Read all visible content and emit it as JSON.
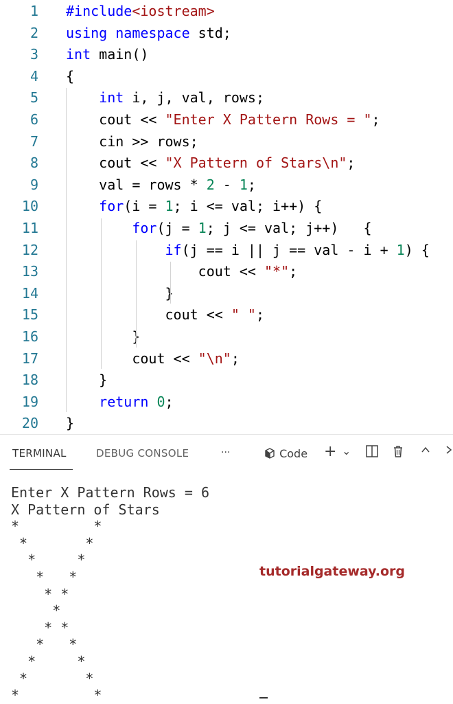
{
  "code": [
    {
      "n": "1",
      "parts": [
        {
          "t": "#include",
          "c": "kw"
        },
        {
          "t": "<iostream>",
          "c": "str"
        }
      ]
    },
    {
      "n": "2",
      "parts": [
        {
          "t": "using namespace",
          "c": "kw"
        },
        {
          "t": " std;",
          "c": ""
        }
      ]
    },
    {
      "n": "3",
      "parts": [
        {
          "t": "int",
          "c": "kw"
        },
        {
          "t": " main()",
          "c": ""
        }
      ]
    },
    {
      "n": "4",
      "parts": [
        {
          "t": "{",
          "c": ""
        }
      ]
    },
    {
      "n": "5",
      "parts": [
        {
          "t": "    ",
          "c": ""
        },
        {
          "t": "int",
          "c": "kw"
        },
        {
          "t": " i, j, val, rows;",
          "c": ""
        }
      ]
    },
    {
      "n": "6",
      "parts": [
        {
          "t": "    cout << ",
          "c": ""
        },
        {
          "t": "\"Enter X Pattern Rows = \"",
          "c": "str"
        },
        {
          "t": ";",
          "c": ""
        }
      ]
    },
    {
      "n": "7",
      "parts": [
        {
          "t": "    cin >> rows;",
          "c": ""
        }
      ]
    },
    {
      "n": "8",
      "parts": [
        {
          "t": "    cout << ",
          "c": ""
        },
        {
          "t": "\"X Pattern of Stars\\n\"",
          "c": "str"
        },
        {
          "t": ";",
          "c": ""
        }
      ]
    },
    {
      "n": "9",
      "parts": [
        {
          "t": "    val = rows * ",
          "c": ""
        },
        {
          "t": "2",
          "c": "num"
        },
        {
          "t": " - ",
          "c": ""
        },
        {
          "t": "1",
          "c": "num"
        },
        {
          "t": ";",
          "c": ""
        }
      ]
    },
    {
      "n": "10",
      "parts": [
        {
          "t": "    ",
          "c": ""
        },
        {
          "t": "for",
          "c": "kw"
        },
        {
          "t": "(i = ",
          "c": ""
        },
        {
          "t": "1",
          "c": "num"
        },
        {
          "t": "; i <= val; i++) {",
          "c": ""
        }
      ]
    },
    {
      "n": "11",
      "parts": [
        {
          "t": "        ",
          "c": ""
        },
        {
          "t": "for",
          "c": "kw"
        },
        {
          "t": "(j = ",
          "c": ""
        },
        {
          "t": "1",
          "c": "num"
        },
        {
          "t": "; j <= val; j++)   {",
          "c": ""
        }
      ]
    },
    {
      "n": "12",
      "parts": [
        {
          "t": "            ",
          "c": ""
        },
        {
          "t": "if",
          "c": "kw"
        },
        {
          "t": "(j == i || j == val - i + ",
          "c": ""
        },
        {
          "t": "1",
          "c": "num"
        },
        {
          "t": ") {",
          "c": ""
        }
      ]
    },
    {
      "n": "13",
      "parts": [
        {
          "t": "                cout << ",
          "c": ""
        },
        {
          "t": "\"*\"",
          "c": "str"
        },
        {
          "t": ";",
          "c": ""
        }
      ]
    },
    {
      "n": "14",
      "parts": [
        {
          "t": "            }",
          "c": ""
        }
      ]
    },
    {
      "n": "15",
      "parts": [
        {
          "t": "            cout << ",
          "c": ""
        },
        {
          "t": "\" \"",
          "c": "str"
        },
        {
          "t": ";",
          "c": ""
        }
      ]
    },
    {
      "n": "16",
      "parts": [
        {
          "t": "        }",
          "c": ""
        }
      ]
    },
    {
      "n": "17",
      "parts": [
        {
          "t": "        cout << ",
          "c": ""
        },
        {
          "t": "\"\\n\"",
          "c": "str"
        },
        {
          "t": ";",
          "c": ""
        }
      ]
    },
    {
      "n": "18",
      "parts": [
        {
          "t": "    }",
          "c": ""
        }
      ]
    },
    {
      "n": "19",
      "parts": [
        {
          "t": "    ",
          "c": ""
        },
        {
          "t": "return",
          "c": "kw"
        },
        {
          "t": " ",
          "c": ""
        },
        {
          "t": "0",
          "c": "num"
        },
        {
          "t": ";",
          "c": ""
        }
      ]
    },
    {
      "n": "20",
      "parts": [
        {
          "t": "}",
          "c": ""
        }
      ]
    }
  ],
  "panel": {
    "tab_terminal": "TERMINAL",
    "tab_debug": "DEBUG CONSOLE",
    "more": "···",
    "code_profile": "Code",
    "plus": "+",
    "chevron": "⌄",
    "split": "◫",
    "trash": "🗑",
    "up": "⌃",
    "close": "›"
  },
  "terminal_lines": [
    "Enter X Pattern Rows = 6",
    "X Pattern of Stars",
    "*         *",
    " *       *",
    "  *     *",
    "   *   *",
    "    * *",
    "     *",
    "    * *",
    "   *   *",
    "  *     *",
    " *       *",
    "*         *"
  ],
  "watermark": "tutorialgateway.org",
  "colors": {
    "keyword": "#0000ff",
    "string": "#a31515",
    "number": "#098658",
    "line_number": "#237893",
    "watermark": "#a52a2a"
  }
}
